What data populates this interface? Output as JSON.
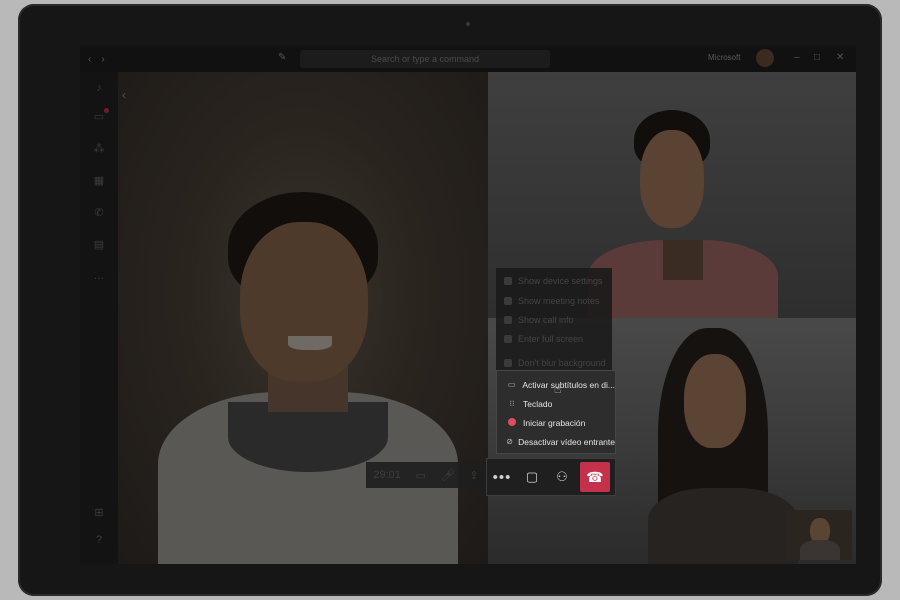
{
  "titlebar": {
    "search_placeholder": "Search or type a command",
    "org": "Microsoft"
  },
  "call_menu": {
    "dimmed_items": [
      "Show device settings",
      "Show meeting notes",
      "Show call info",
      "Enter full screen",
      "Don't blur background"
    ],
    "items": [
      {
        "label": "Activar subtítulos en di...",
        "icon": "captions-icon"
      },
      {
        "label": "Teclado",
        "icon": "dialpad-icon"
      },
      {
        "label": "Iniciar grabación",
        "icon": "record-icon"
      },
      {
        "label": "Desactivar vídeo entrante",
        "icon": "video-off-icon"
      }
    ]
  },
  "controls": {
    "timer": "29:01",
    "buttons": [
      "camera-icon",
      "mic-icon",
      "share-icon",
      "more-options-icon",
      "chat-icon",
      "participants-icon",
      "hangup-icon"
    ]
  },
  "colors": {
    "hangup": "#c4314b",
    "record": "#e04d5a",
    "menu_bg": "#2d2d2d"
  }
}
